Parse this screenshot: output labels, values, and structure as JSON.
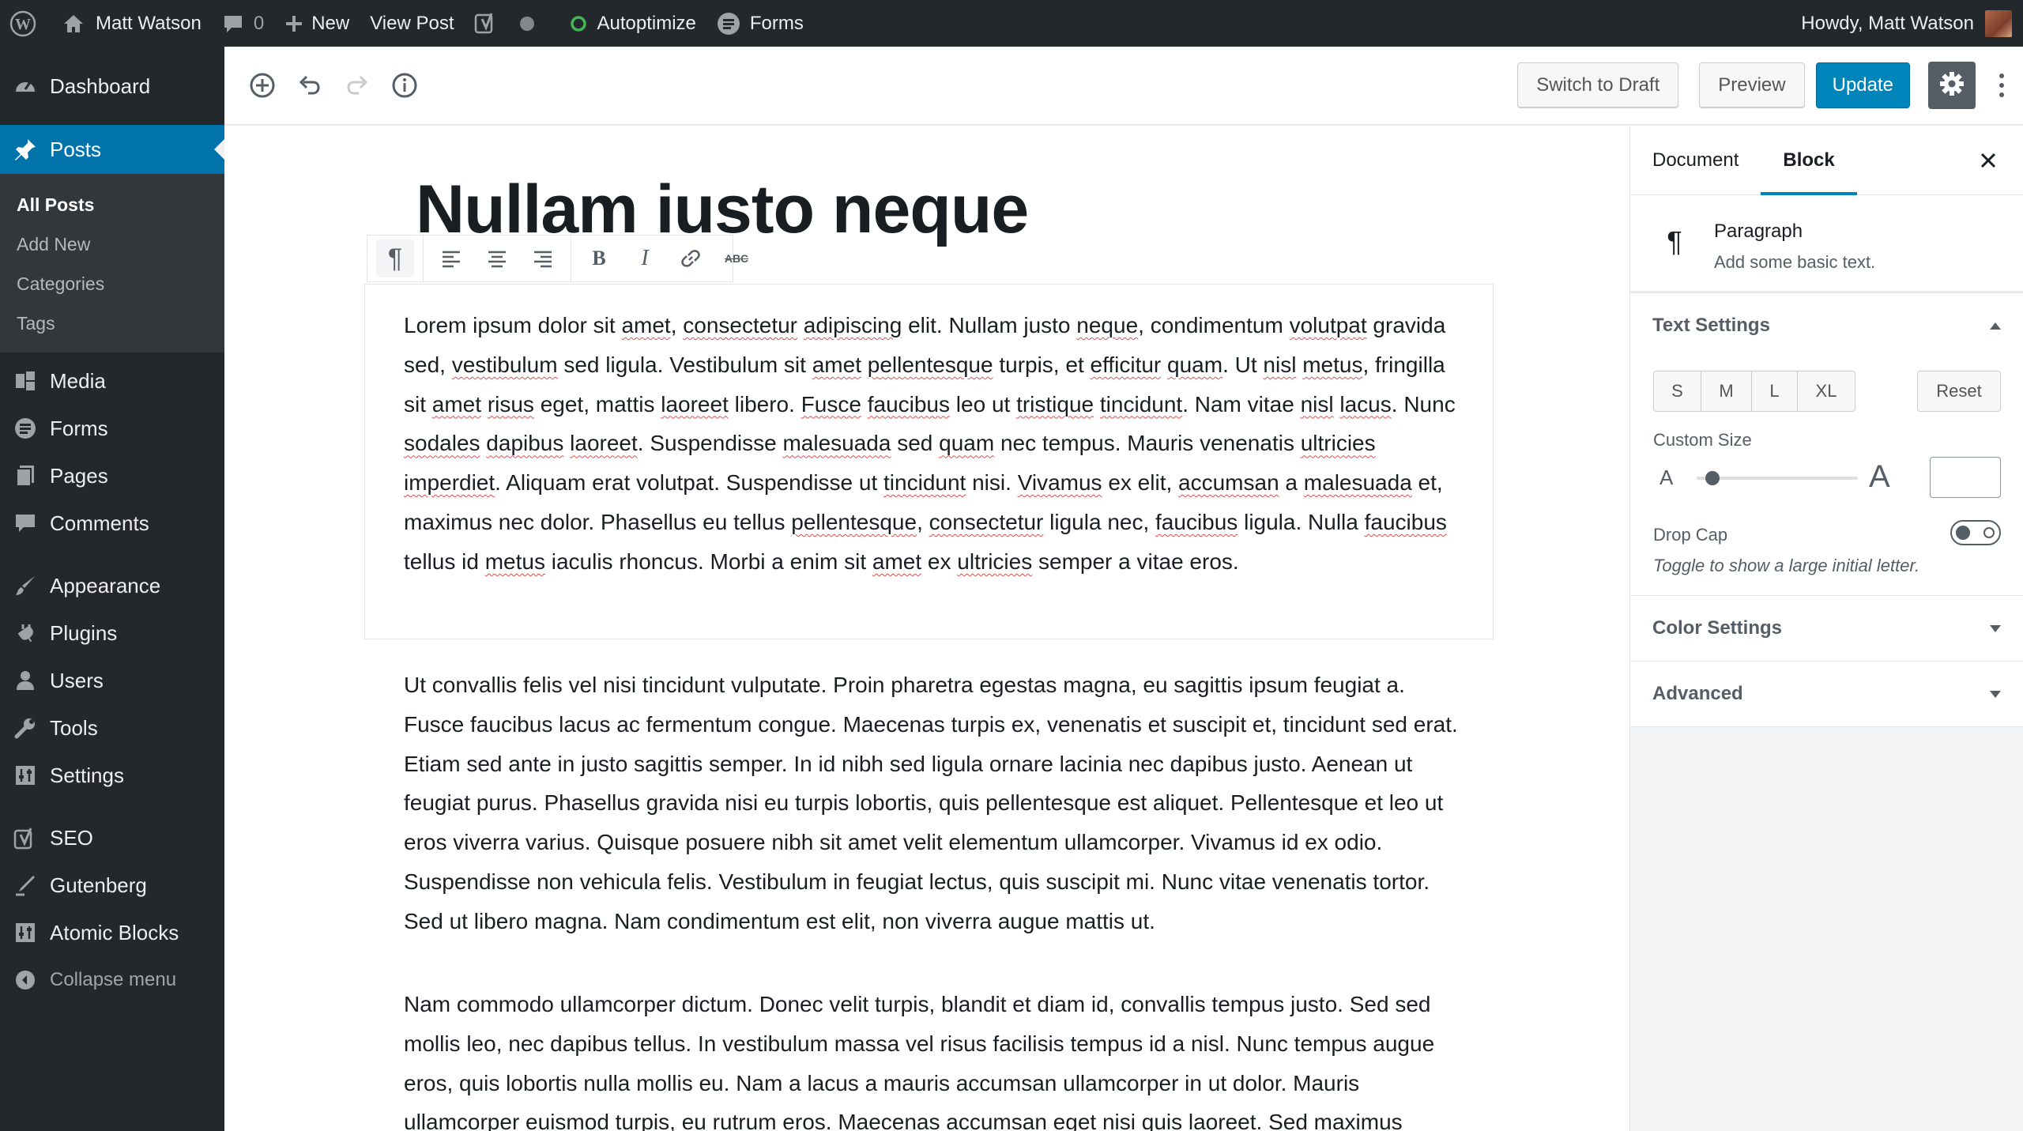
{
  "admin_bar": {
    "site_name": "Matt Watson",
    "comments_count": "0",
    "new_label": "New",
    "view_post_label": "View Post",
    "autoptimize_label": "Autoptimize",
    "forms_label": "Forms",
    "greeting": "Howdy, Matt Watson"
  },
  "sidebar": {
    "dashboard": "Dashboard",
    "posts": "Posts",
    "posts_sub": [
      "All Posts",
      "Add New",
      "Categories",
      "Tags"
    ],
    "media": "Media",
    "forms": "Forms",
    "pages": "Pages",
    "comments": "Comments",
    "appearance": "Appearance",
    "plugins": "Plugins",
    "users": "Users",
    "tools": "Tools",
    "settings": "Settings",
    "seo": "SEO",
    "gutenberg": "Gutenberg",
    "atomic_blocks": "Atomic Blocks",
    "collapse": "Collapse menu"
  },
  "header": {
    "switch_to_draft": "Switch to Draft",
    "preview": "Preview",
    "update": "Update"
  },
  "post": {
    "title": "Nullam iusto neque",
    "p1_tail": "a vitae eros.",
    "p2": "Ut convallis felis vel nisi tincidunt vulputate. Proin pharetra egestas magna, eu sagittis ipsum feugiat a. Fusce faucibus lacus ac fermentum congue. Maecenas turpis ex, venenatis et suscipit et, tincidunt sed erat. Etiam sed ante in justo sagittis semper. In id nibh sed ligula ornare lacinia nec dapibus justo. Aenean ut feugiat purus. Phasellus gravida nisi eu turpis lobortis, quis pellentesque est aliquet. Pellentesque et leo ut eros viverra varius. Quisque posuere nibh sit amet velit elementum ullamcorper. Vivamus id ex odio. Suspendisse non vehicula felis. Vestibulum in feugiat lectus, quis suscipit mi. Nunc vitae venenatis tortor. Sed ut libero magna. Nam condimentum est elit, non viverra augue mattis ut.",
    "p3": "Nam commodo ullamcorper dictum. Donec velit turpis, blandit et diam id, convallis tempus justo. Sed sed mollis leo, nec dapibus tellus. In vestibulum massa vel risus facilisis tempus id a nisl. Nunc tempus augue eros, quis lobortis nulla mollis eu. Nam a lacus a mauris accumsan ullamcorper in ut dolor. Mauris ullamcorper euismod turpis, eu rutrum eros. Maecenas accumsan eget nisi quis laoreet. Sed maximus"
  },
  "toolbar": {
    "paragraph_glyph": "¶",
    "bold_glyph": "B",
    "italic_glyph": "I",
    "strikethrough_glyph": "ABC"
  },
  "settings_panel": {
    "tab_document": "Document",
    "tab_block": "Block",
    "block_name": "Paragraph",
    "block_description": "Add some basic text.",
    "text_settings": "Text Settings",
    "sizes": [
      "S",
      "M",
      "L",
      "XL"
    ],
    "reset": "Reset",
    "custom_size": "Custom Size",
    "a_small": "A",
    "a_large": "A",
    "drop_cap": "Drop Cap",
    "drop_cap_help": "Toggle to show a large initial letter.",
    "drop_cap_enabled": false,
    "color_settings": "Color Settings",
    "advanced": "Advanced"
  },
  "colors": {
    "admin_bar_bg": "#23282d",
    "accent": "#0073aa",
    "primary_button": "#0085ba"
  },
  "icons": [
    "wordpress-logo-icon",
    "home-icon",
    "comment-icon",
    "plus-icon",
    "yoast-icon",
    "status-dot-icon",
    "autoptimize-icon",
    "forms-icon",
    "dashboard-icon",
    "pin-icon",
    "media-icon",
    "pages-icon",
    "comments-icon",
    "appearance-icon",
    "plugins-icon",
    "users-icon",
    "tools-icon",
    "settings-icon",
    "seo-icon",
    "gutenberg-icon",
    "atomic-blocks-icon",
    "collapse-icon",
    "add-block-icon",
    "undo-icon",
    "redo-icon",
    "info-icon",
    "gear-icon",
    "more-icon",
    "close-icon"
  ]
}
